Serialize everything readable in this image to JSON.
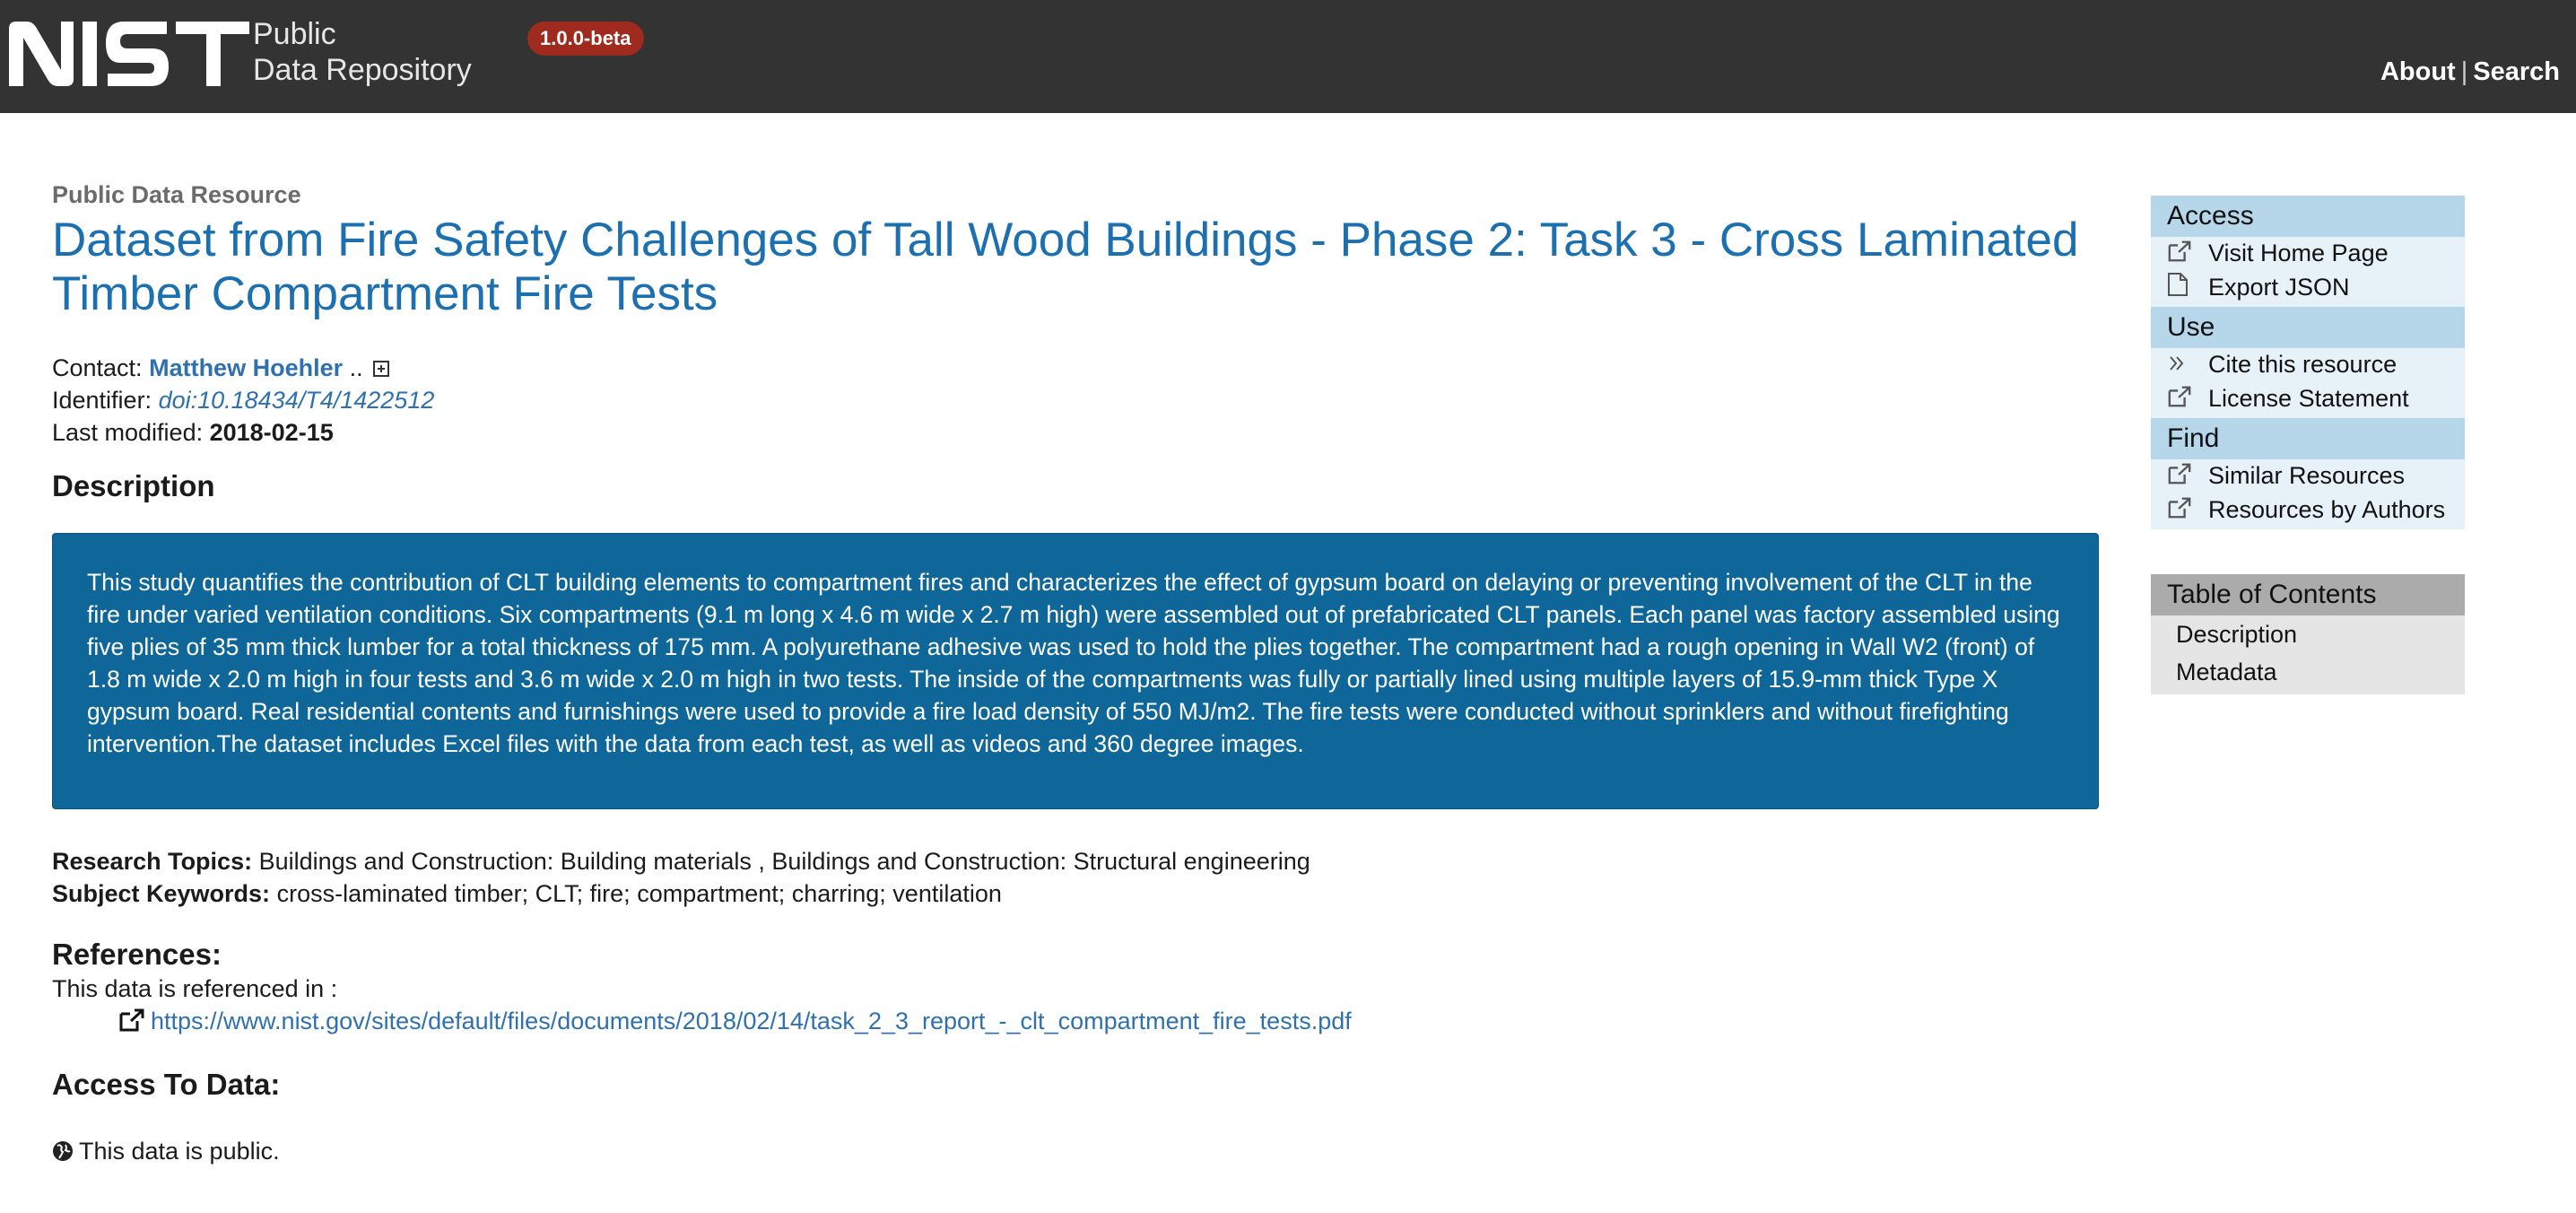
{
  "header": {
    "logo_text": "NIST",
    "repo_name_line1": "Public",
    "repo_name_line2": "Data Repository",
    "version": "1.0.0-beta",
    "nav_about": "About",
    "nav_separator": "|",
    "nav_search": "Search",
    "background_color": "#333333",
    "badge_color": "#9e2b1e"
  },
  "resource": {
    "type_label": "Public Data Resource",
    "title": "Dataset from Fire Safety Challenges of Tall Wood Buildings - Phase 2: Task 3 - Cross Laminated Timber Compartment Fire Tests",
    "contact_label": "Contact:",
    "contact_name": "Matthew Hoehler",
    "contact_more": "..",
    "identifier_label": "Identifier:",
    "identifier": "doi:10.18434/T4/1422512",
    "modified_label": "Last modified:",
    "modified": "2018-02-15"
  },
  "description": {
    "heading": "Description",
    "text": "This study quantifies the contribution of CLT building elements to compartment fires and characterizes the effect of gypsum board on delaying or preventing involvement of the CLT in the fire under varied ventilation conditions. Six compartments (9.1 m long x 4.6 m wide x 2.7 m high) were assembled out of prefabricated CLT panels. Each panel was factory assembled using five plies of 35 mm thick lumber for a total thickness of 175 mm. A polyurethane adhesive was used to hold the plies together. The compartment had a rough opening in Wall W2 (front) of 1.8 m wide x 2.0 m high in four tests and 3.6 m wide x 2.0 m high in two tests. The inside of the compartments was fully or partially lined using multiple layers of 15.9-mm thick Type X gypsum board. Real residential contents and furnishings were used to provide a fire load density of 550 MJ/m2. The fire tests were conducted without sprinklers and without firefighting intervention.The dataset includes Excel files with the data from each test, as well as videos and 360 degree images.",
    "box_color": "#0e6699"
  },
  "topics": {
    "research_label": "Research Topics:",
    "research_value": "Buildings and Construction: Building materials , Buildings and Construction: Structural engineering",
    "keywords_label": "Subject Keywords:",
    "keywords_value": "cross-laminated timber; CLT; fire; compartment; charring; ventilation"
  },
  "references": {
    "heading": "References:",
    "intro": "This data is referenced in :",
    "link": "https://www.nist.gov/sites/default/files/documents/2018/02/14/task_2_3_report_-_clt_compartment_fire_tests.pdf"
  },
  "access_data": {
    "heading": "Access To Data:",
    "public_text": "This data is public."
  },
  "sidebar": {
    "groups": [
      {
        "heading": "Access",
        "items": [
          {
            "label": "Visit Home Page",
            "icon": "external-link-icon"
          },
          {
            "label": "Export JSON",
            "icon": "file-icon"
          }
        ]
      },
      {
        "heading": "Use",
        "items": [
          {
            "label": "Cite this resource",
            "icon": "double-chevron-icon"
          },
          {
            "label": "License Statement",
            "icon": "external-link-icon"
          }
        ]
      },
      {
        "heading": "Find",
        "items": [
          {
            "label": "Similar Resources",
            "icon": "external-link-icon"
          },
          {
            "label": "Resources by Authors",
            "icon": "external-link-icon"
          }
        ]
      }
    ],
    "toc_heading": "Table of Contents",
    "toc_items": [
      "Description",
      "Metadata"
    ],
    "group_header_color": "#b6d6ea",
    "toc_header_color": "#ababab"
  }
}
